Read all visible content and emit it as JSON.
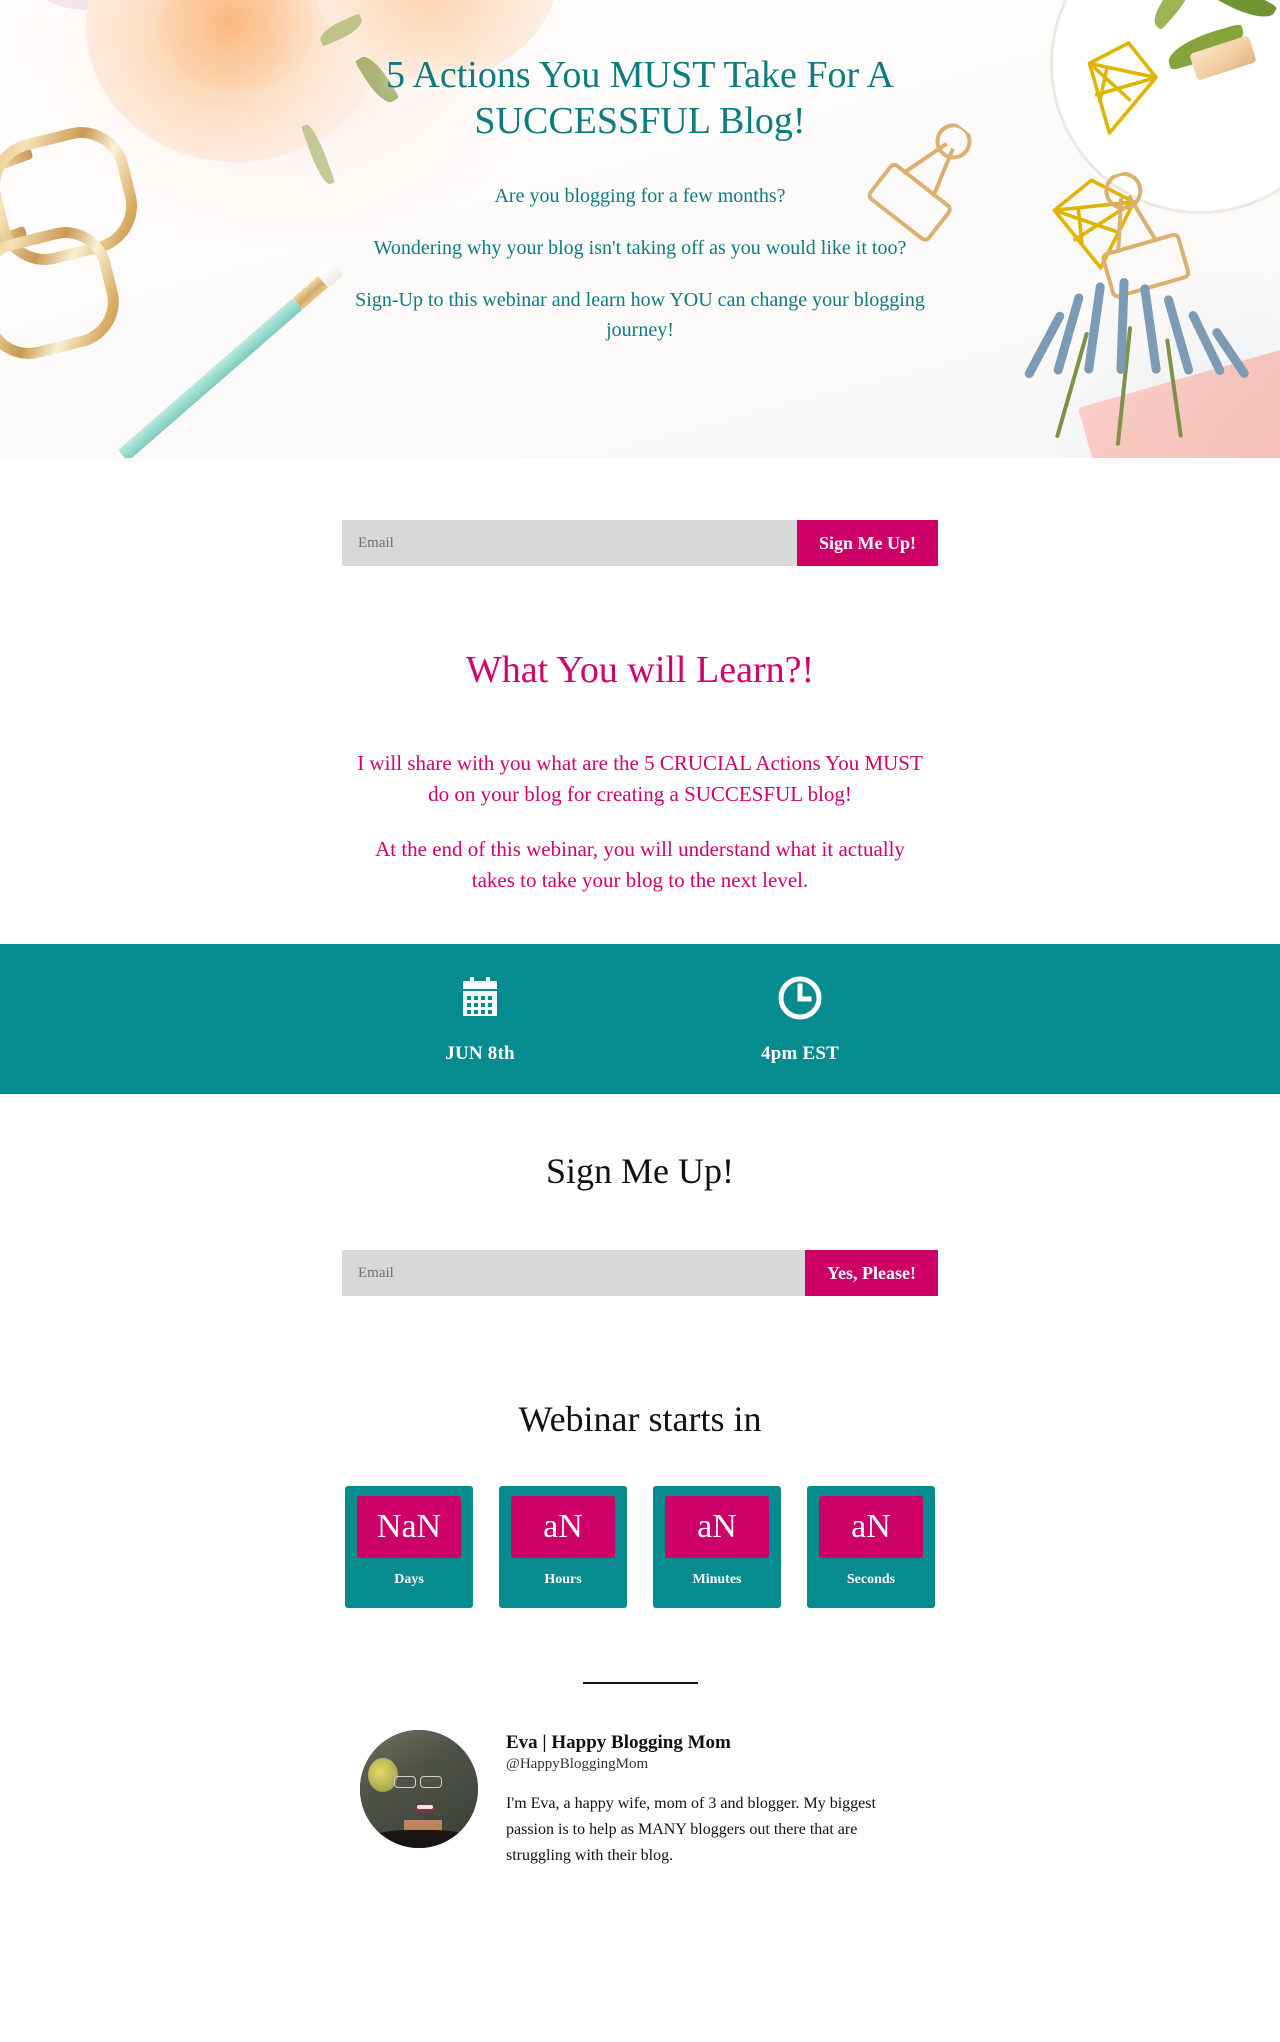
{
  "hero": {
    "title": "5 Actions You MUST Take For A SUCCESSFUL Blog!",
    "sub1": "Are you blogging for a few months?",
    "sub2": "Wondering why your blog isn't taking off as you would like it too?",
    "sub3": "Sign-Up to this webinar and learn how YOU can change your blogging journey!"
  },
  "form_top": {
    "placeholder": "Email",
    "value": "",
    "button_label": "Sign Me Up!"
  },
  "learn": {
    "title": "What You will Learn?!",
    "para1": "I will share with you what are the 5 CRUCIAL Actions You MUST do on your blog for creating a SUCCESFUL blog!",
    "para2": "At the end of this webinar, you will understand what it actually takes to take your blog to the next level."
  },
  "band": {
    "date_icon": "calendar-icon",
    "date_label": "JUN 8th",
    "time_icon": "clock-icon",
    "time_label": "4pm EST"
  },
  "signup": {
    "heading": "Sign Me Up!",
    "placeholder": "Email",
    "value": "",
    "button_label": "Yes, Please!"
  },
  "countdown": {
    "heading": "Webinar starts in",
    "units": [
      {
        "value": "NaN",
        "label": "Days"
      },
      {
        "value": "aN",
        "label": "Hours"
      },
      {
        "value": "aN",
        "label": "Minutes"
      },
      {
        "value": "aN",
        "label": "Seconds"
      }
    ]
  },
  "bio": {
    "name": "Eva | Happy Blogging Mom",
    "handle": "@HappyBloggingMom",
    "description": "I'm Eva, a happy wife, mom of 3 and blogger. My biggest passion is to help as MANY bloggers out there that are struggling with their blog."
  },
  "colors": {
    "teal": "#068B8F",
    "teal_text": "#0d7b80",
    "magenta": "#cc0066",
    "pink_heading": "#d1026b",
    "input_gray": "#d8d8d8"
  }
}
